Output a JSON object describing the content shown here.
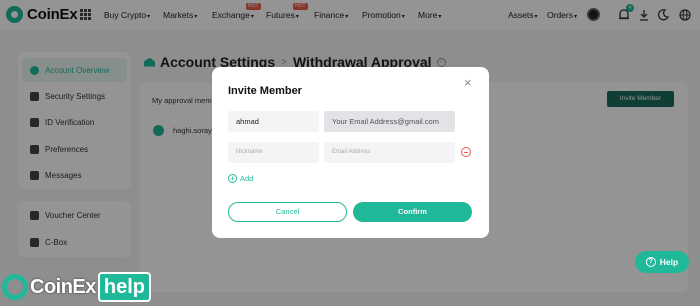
{
  "nav": {
    "brand": "CoinEx",
    "items": [
      {
        "label": "Buy Crypto",
        "caret": "▾"
      },
      {
        "label": "Markets",
        "caret": "▾"
      },
      {
        "label": "Exchange",
        "caret": "▾",
        "hot": "HOT"
      },
      {
        "label": "Futures",
        "caret": "▾",
        "hot": "HOT"
      },
      {
        "label": "Finance",
        "caret": "▾"
      },
      {
        "label": "Promotion",
        "caret": "▾"
      },
      {
        "label": "More",
        "caret": "▾"
      }
    ],
    "right": [
      {
        "label": "Assets",
        "caret": "▾"
      },
      {
        "label": "Orders",
        "caret": "▾"
      }
    ],
    "notification_count": "4",
    "icons": [
      "grid-icon",
      "bell-icon",
      "download-icon",
      "moon-icon"
    ]
  },
  "sidebar": {
    "group1": [
      {
        "label": "Account Overview",
        "icon": "pie-chart-icon",
        "active": true
      },
      {
        "label": "Security Settings",
        "icon": "shield-icon"
      },
      {
        "label": "ID Verification",
        "icon": "id-card-icon"
      },
      {
        "label": "Preferences",
        "icon": "sliders-icon"
      },
      {
        "label": "Messages",
        "icon": "message-icon"
      }
    ],
    "group2": [
      {
        "label": "Voucher Center",
        "icon": "voucher-icon"
      },
      {
        "label": "C-Box",
        "icon": "box-icon"
      }
    ]
  },
  "page": {
    "breadcrumb_parent": "Account Settings",
    "breadcrumb_sep": ">",
    "title": "Withdrawal Approval",
    "info_glyph": "i",
    "approval_label": "My approval mem",
    "invite_button": "Invite Member",
    "member_name": "haghi.soray"
  },
  "modal": {
    "title": "Invite Member",
    "close_glyph": "×",
    "row1": {
      "nickname_value": "ahmad",
      "email_value": "Your Email Address@gmail.com"
    },
    "row2": {
      "nickname_placeholder": "Nickname",
      "email_placeholder": "Email Address"
    },
    "add_label": "Add",
    "add_glyph": "+",
    "cancel_label": "Cancel",
    "confirm_label": "Confirm"
  },
  "help": {
    "label": "Help",
    "glyph": "?"
  },
  "watermark": {
    "text": "CoinEx",
    "tag": "help"
  },
  "colors": {
    "accent": "#1fb99a",
    "dark_accent": "#1b6b5a",
    "danger": "#e85d4a",
    "overlay": "rgba(0,0,0,0.42)"
  }
}
